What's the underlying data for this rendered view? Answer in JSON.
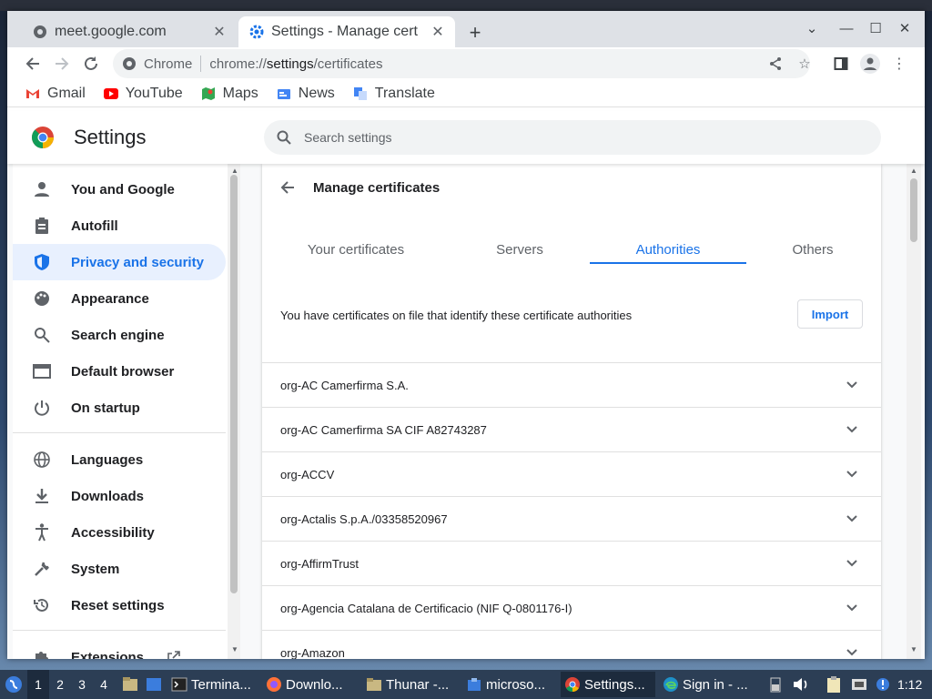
{
  "browser": {
    "tabs": [
      {
        "title": "meet.google.com",
        "active": false
      },
      {
        "title": "Settings - Manage cert",
        "active": true
      }
    ],
    "omnibox": {
      "site_label": "Chrome",
      "url_scheme": "chrome://",
      "url_host": "settings",
      "url_path": "/certificates"
    },
    "bookmarks": [
      {
        "label": "Gmail",
        "icon": "gmail-icon"
      },
      {
        "label": "YouTube",
        "icon": "youtube-icon"
      },
      {
        "label": "Maps",
        "icon": "maps-icon"
      },
      {
        "label": "News",
        "icon": "news-icon"
      },
      {
        "label": "Translate",
        "icon": "translate-icon"
      }
    ]
  },
  "settings": {
    "title": "Settings",
    "search_placeholder": "Search settings",
    "sidebar": [
      {
        "label": "You and Google",
        "icon": "person-icon",
        "selected": false
      },
      {
        "label": "Autofill",
        "icon": "clipboard-icon",
        "selected": false
      },
      {
        "label": "Privacy and security",
        "icon": "shield-icon",
        "selected": true
      },
      {
        "label": "Appearance",
        "icon": "palette-icon",
        "selected": false
      },
      {
        "label": "Search engine",
        "icon": "search-icon",
        "selected": false
      },
      {
        "label": "Default browser",
        "icon": "browser-icon",
        "selected": false
      },
      {
        "label": "On startup",
        "icon": "power-icon",
        "selected": false
      },
      {
        "label": "Languages",
        "icon": "globe-icon",
        "selected": false
      },
      {
        "label": "Downloads",
        "icon": "download-icon",
        "selected": false
      },
      {
        "label": "Accessibility",
        "icon": "accessibility-icon",
        "selected": false
      },
      {
        "label": "System",
        "icon": "wrench-icon",
        "selected": false
      },
      {
        "label": "Reset settings",
        "icon": "history-icon",
        "selected": false
      },
      {
        "label": "Extensions",
        "icon": "puzzle-icon",
        "selected": false
      }
    ],
    "page": {
      "title": "Manage certificates",
      "tabs": [
        "Your certificates",
        "Servers",
        "Authorities",
        "Others"
      ],
      "active_tab": "Authorities",
      "info_text": "You have certificates on file that identify these certificate authorities",
      "import_label": "Import",
      "certificates": [
        "org-AC Camerfirma S.A.",
        "org-AC Camerfirma SA CIF A82743287",
        "org-ACCV",
        "org-Actalis S.p.A./03358520967",
        "org-AffirmTrust",
        "org-Agencia Catalana de Certificacio (NIF Q-0801176-I)",
        "org-Amazon"
      ]
    }
  },
  "taskbar": {
    "workspaces": [
      "1",
      "2",
      "3",
      "4"
    ],
    "tasks": [
      {
        "label": "Termina...",
        "icon": "terminal-icon"
      },
      {
        "label": "Downlo...",
        "icon": "firefox-icon"
      },
      {
        "label": "Thunar -...",
        "icon": "folder-icon"
      },
      {
        "label": "microso...",
        "icon": "package-icon"
      },
      {
        "label": "Settings...",
        "icon": "chrome-icon"
      },
      {
        "label": "Sign in - ...",
        "icon": "edge-icon"
      }
    ],
    "clock": "1:12"
  },
  "colors": {
    "accent": "#1a73e8",
    "selected_bg": "#e8f0fe",
    "taskbar": "#2c3e55"
  }
}
